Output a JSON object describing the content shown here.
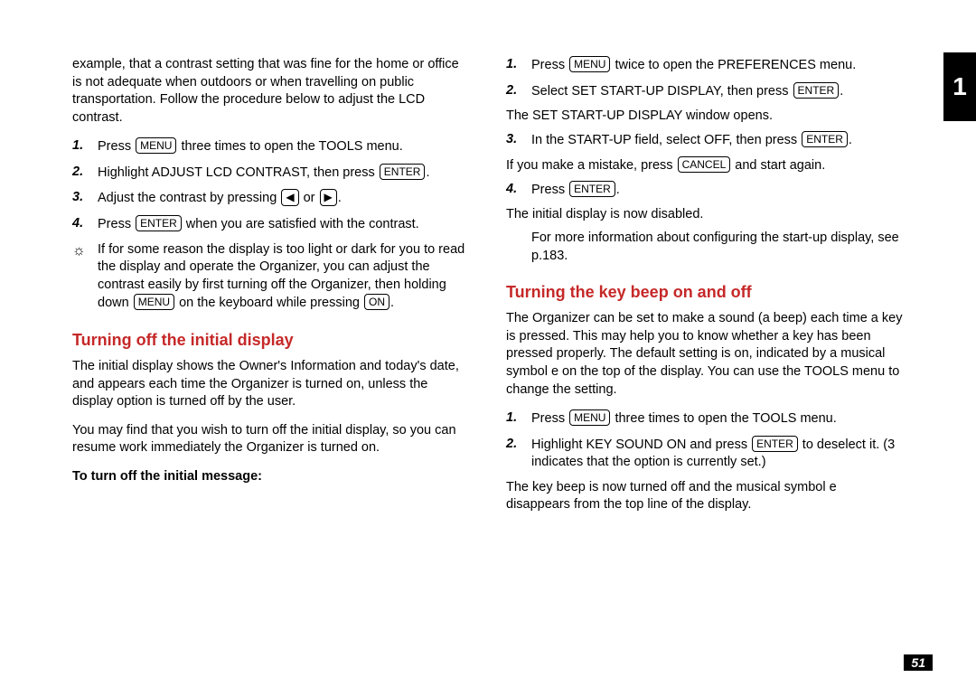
{
  "tab": "1",
  "pageNumber": "51",
  "keys": {
    "menu": "MENU",
    "enter": "ENTER",
    "on": "ON",
    "cancel": "CANCEL",
    "left": "◀",
    "right": "▶"
  },
  "left": {
    "intro": "example, that a contrast setting that was fine for the home or office is not adequate when outdoors or when travelling on public transportation. Follow the procedure below to adjust the LCD contrast.",
    "s1_a": "Press ",
    "s1_b": " three times to open the TOOLS menu.",
    "s2_a": "Highlight ADJUST LCD CONTRAST, then press ",
    "s2_b": ".",
    "s3_a": "Adjust the contrast by pressing ",
    "s3_or": " or ",
    "s3_b": ".",
    "s4_a": "Press ",
    "s4_b": " when you are satisfied with the contrast.",
    "tip_a": "If for some reason the display is too light or dark for you to read the display and operate the Organizer, you can adjust the contrast easily by first turning off the Organizer, then holding down ",
    "tip_b": " on the keyboard while pressing ",
    "tip_c": ".",
    "h1": "Turning off the initial display",
    "p1": "The initial display shows the Owner's Information and today's date, and appears each time the Organizer is turned on, unless the display option is turned off by the user.",
    "p2": "You may find that you wish to turn off the initial display, so you can resume work immediately the Organizer is turned on.",
    "sub": "To turn off the initial message:"
  },
  "right": {
    "s1_a": "Press ",
    "s1_b": " twice to open the PREFERENCES menu.",
    "s2_a": "Select SET START-UP DISPLAY, then press ",
    "s2_b": ".",
    "note1": "The SET START-UP DISPLAY window opens.",
    "s3_a": "In the START-UP field, select OFF, then press ",
    "s3_b": ".",
    "note2_a": "If you make a mistake, press ",
    "note2_b": " and start again.",
    "s4_a": "Press ",
    "s4_b": ".",
    "note3": "The initial display is now disabled.",
    "info": "For more information about configuring the start-up display, see p.183.",
    "h2": "Turning the key beep on and off",
    "p3": "The Organizer can be set to make a sound (a beep) each time a key is pressed. This may help you to know whether a key has been pressed properly. The default setting is on, indicated by a musical symbol e on the top of the display. You can use the TOOLS menu to change the setting.",
    "b1_a": "Press ",
    "b1_b": " three times to open the TOOLS menu.",
    "b2_a": "Highlight KEY SOUND ON and press ",
    "b2_b": " to deselect it. (3 indicates that the option is currently set.)",
    "p4": "The key beep is now turned off and the musical symbol e disappears from the top line of the display."
  }
}
